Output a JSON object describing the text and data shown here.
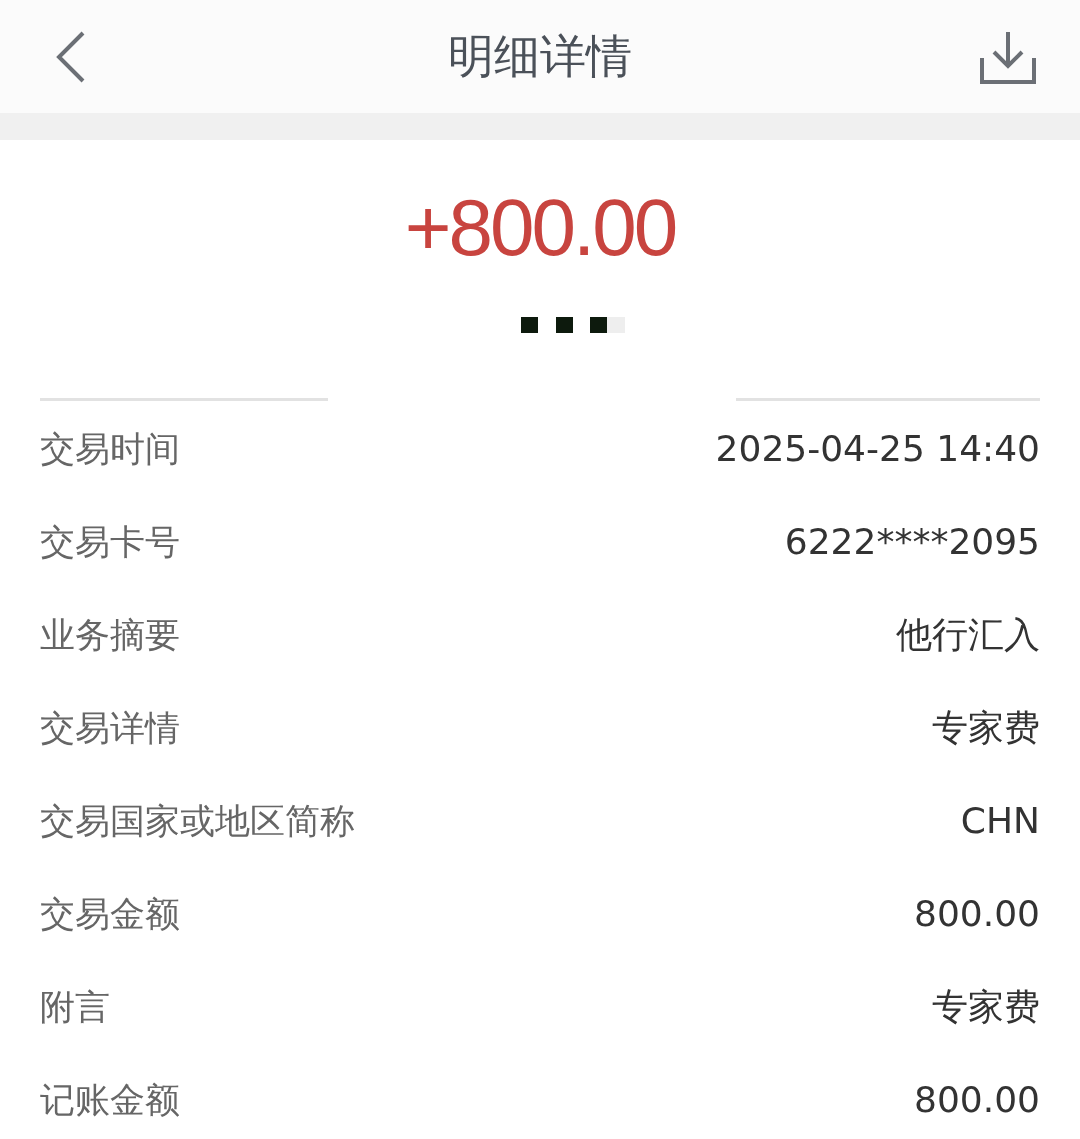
{
  "header": {
    "title": "明细详情"
  },
  "amount": "+800.00",
  "details": [
    {
      "label": "交易时间",
      "value": "2025-04-25 14:40"
    },
    {
      "label": "交易卡号",
      "value": "6222****2095"
    },
    {
      "label": "业务摘要",
      "value": "他行汇入"
    },
    {
      "label": "交易详情",
      "value": "专家费"
    },
    {
      "label": "交易国家或地区简称",
      "value": "CHN"
    },
    {
      "label": "交易金额",
      "value": "800.00"
    },
    {
      "label": "附言",
      "value": "专家费"
    },
    {
      "label": "记账金额",
      "value": "800.00"
    }
  ]
}
